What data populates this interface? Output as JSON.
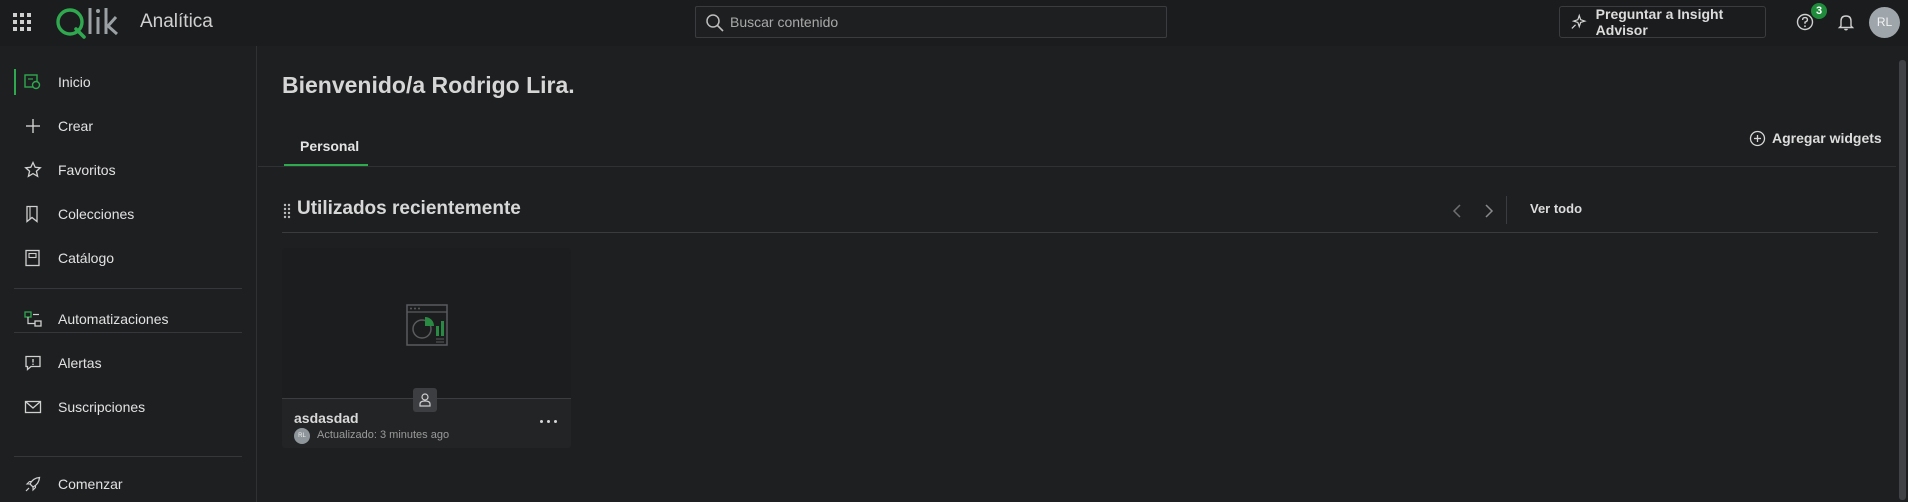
{
  "header": {
    "app_title": "Analítica",
    "search_placeholder": "Buscar contenido",
    "insight_button": "Preguntar a Insight Advisor",
    "notification_count": "3",
    "user_initials": "RL"
  },
  "sidebar": {
    "items": [
      {
        "label": "Inicio",
        "icon": "home-icon",
        "active": true
      },
      {
        "label": "Crear",
        "icon": "plus-icon"
      },
      {
        "label": "Favoritos",
        "icon": "star-icon"
      },
      {
        "label": "Colecciones",
        "icon": "bookmark-icon"
      },
      {
        "label": "Catálogo",
        "icon": "catalog-icon"
      },
      {
        "label": "Automatizaciones",
        "icon": "automation-icon"
      },
      {
        "label": "Alertas",
        "icon": "alert-icon"
      },
      {
        "label": "Suscripciones",
        "icon": "mail-icon"
      },
      {
        "label": "Comenzar",
        "icon": "rocket-icon"
      }
    ]
  },
  "main": {
    "welcome": "Bienvenido/a Rodrigo Lira.",
    "tabs": [
      {
        "label": "Personal",
        "active": true
      }
    ],
    "add_widgets": "Agregar widgets",
    "section": {
      "title": "Utilizados recientemente",
      "see_all": "Ver todo",
      "cards": [
        {
          "title": "asdasdad",
          "owner_initials": "RL",
          "updated": "Actualizado: 3 minutes ago"
        }
      ]
    }
  },
  "colors": {
    "accent": "#2fa84f",
    "background": "#1e1f21",
    "topbar": "#1b1c1e"
  }
}
